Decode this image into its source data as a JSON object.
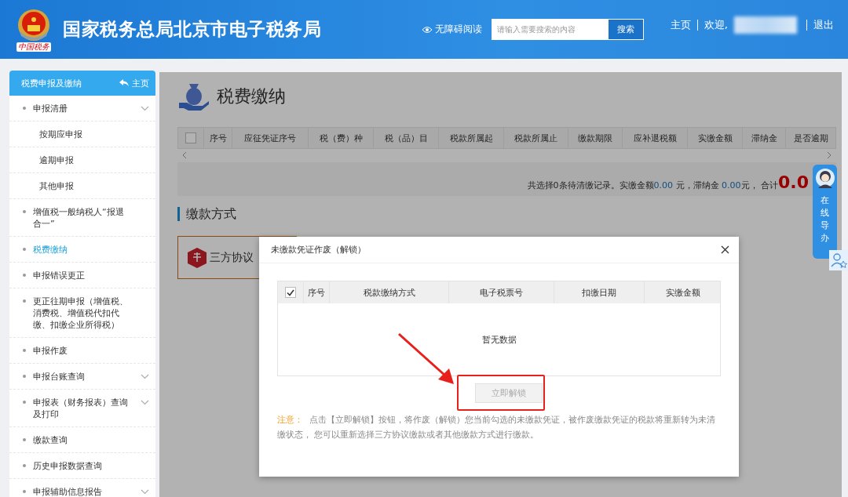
{
  "header": {
    "emblem_text": "中国税务",
    "title": "国家税务总局北京市电子税务局",
    "accessibility_link": "无障碍阅读",
    "search": {
      "placeholder": "请输入需要搜索的内容",
      "button": "搜索"
    },
    "home_link": "主页",
    "welcome": "欢迎,",
    "logout": "退出"
  },
  "sidebar": {
    "title": "税费申报及缴纳",
    "home_link": "主页",
    "items": [
      {
        "label": "申报清册",
        "has_submenu": true,
        "selected": false,
        "children": [
          {
            "label": "按期应申报",
            "selected": false
          },
          {
            "label": "逾期申报",
            "selected": false
          },
          {
            "label": "其他申报",
            "selected": false
          }
        ]
      },
      {
        "label": "增值税一般纳税人“报退合一”",
        "has_submenu": false,
        "selected": false
      },
      {
        "label": "税费缴纳",
        "has_submenu": false,
        "selected": true
      },
      {
        "label": "申报错误更正",
        "has_submenu": false,
        "selected": false
      },
      {
        "label": "更正往期申报（增值税、消费税、增值税代扣代缴、扣缴企业所得税）",
        "has_submenu": false,
        "selected": false
      },
      {
        "label": "申报作废",
        "has_submenu": false,
        "selected": false
      },
      {
        "label": "申报台账查询",
        "has_submenu": true,
        "selected": false
      },
      {
        "label": "申报表（财务报表）查询及打印",
        "has_submenu": true,
        "selected": false
      },
      {
        "label": "缴款查询",
        "has_submenu": false,
        "selected": false
      },
      {
        "label": "历史申报数据查询",
        "has_submenu": false,
        "selected": false
      },
      {
        "label": "申报辅助信息报告",
        "has_submenu": true,
        "selected": false
      }
    ]
  },
  "page": {
    "title": "税费缴纳",
    "table": {
      "header_checked": false,
      "columns": [
        "序号",
        "应征凭证序号",
        "税（费）种",
        "税（品）目",
        "税款所属起",
        "税款所属止",
        "缴款期限",
        "应补退税额",
        "实缴金额",
        "滞纳金",
        "是否逾期"
      ]
    },
    "summary": {
      "prefix": "共选择0条待清缴记录。实缴金额",
      "paid": "0.00",
      "middle": " 元，滞纳金 ",
      "late_fee": "0.00",
      "suffix": "元， 合计",
      "total": "0.0"
    },
    "section_title": "缴款方式",
    "payment_methods": [
      {
        "label": "三方协议",
        "selected": true
      }
    ]
  },
  "float_widget": {
    "label": "在线导办"
  },
  "dialog": {
    "title": "未缴款凭证作废（解锁）",
    "table": {
      "header_checked": true,
      "columns": [
        "序号",
        "税款缴纳方式",
        "电子税票号",
        "扣缴日期",
        "实缴金额"
      ]
    },
    "empty_text": "暂无数据",
    "button": {
      "label": "立即解锁",
      "disabled": true
    },
    "note": {
      "label": "注意：",
      "text": "点击【立即解锁】按钮，将作废（解锁）您当前勾选的未缴款凭证，被作废缴款凭证的税款将重新转为未清缴状态， 您可以重新选择三方协议缴款或者其他缴款方式进行缴款。"
    }
  }
}
